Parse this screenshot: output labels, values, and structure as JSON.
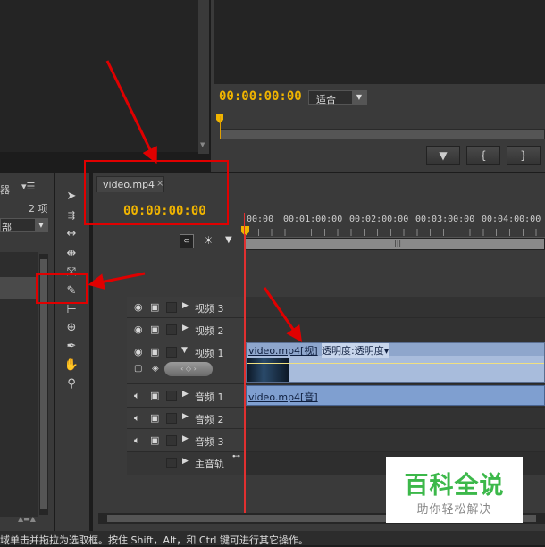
{
  "monitor": {
    "timecode": "00:00:00:00",
    "fit_value": "适合",
    "buttons": [
      "▼",
      "{",
      "}"
    ]
  },
  "project": {
    "tab_fragment": "器",
    "item_count": "2 项",
    "dropdown_fragment": "部"
  },
  "sequence": {
    "tab_label": "video.mp4",
    "tab_close": "×",
    "timecode": "00:00:00:00",
    "ruler": [
      "00:00",
      "00:01:00:00",
      "00:02:00:00",
      "00:03:00:00",
      "00:04:00:00"
    ],
    "tracks": [
      {
        "label": "视频 3"
      },
      {
        "label": "视频 2"
      },
      {
        "label": "视频 1"
      },
      {
        "label": "音频 1"
      },
      {
        "label": "音频 2"
      },
      {
        "label": "音频 3"
      },
      {
        "label": "主音轨"
      }
    ],
    "video_clip": {
      "name": "video.mp4[视]",
      "effect": "透明度:透明度▾"
    },
    "audio_clip": {
      "name": "video.mp4[音]"
    }
  },
  "status_bar": "域单击并拖拉为选取框。按住 Shift，Alt，和 Ctrl 键可进行其它操作。",
  "watermark": {
    "title": "百科全说",
    "subtitle": "助你轻松解决"
  },
  "colors": {
    "timecode": "#f0b400",
    "annotation": "#e00000",
    "clip": "#7f9fd0",
    "playhead": "#e03030"
  }
}
